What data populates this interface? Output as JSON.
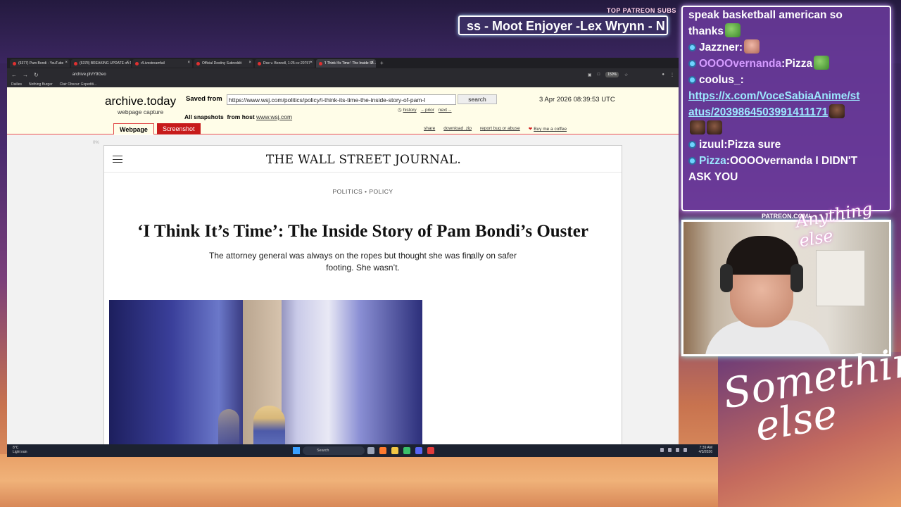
{
  "stream": {
    "patreon_label": "TOP PATREON SUBS",
    "ticker_text": "ss - Moot Enjoyer -Lex Wrynn -  N",
    "cam_label": "PATREON.COM/",
    "cam_signature": "Anything else",
    "big_signature": "Something else"
  },
  "chat": [
    {
      "user": "",
      "text": "speak basketball american so",
      "color": "#ffffff"
    },
    {
      "user": "",
      "text": "thanks",
      "color": "#ffffff",
      "emote": "frog"
    },
    {
      "user": "Jazzner",
      "text": "",
      "color": "#ffffff",
      "emote": "face"
    },
    {
      "user": "OOOOvernanda",
      "text": "Pizza",
      "color": "#d49bff",
      "emote": "frog"
    },
    {
      "user": "coolus_",
      "text": "",
      "color": "#ffffff"
    },
    {
      "user": "",
      "text": "https://x.com/VoceSabiaAnime/st",
      "color": "#9ce8ff",
      "link": true
    },
    {
      "user": "",
      "text": "atus/2039864503991411171",
      "color": "#9ce8ff",
      "link": true,
      "emote": "dark"
    },
    {
      "user": "izuul",
      "text": "Pizza sure",
      "color": "#ffffff"
    },
    {
      "user": "Pizza",
      "text": "OOOOvernanda I DIDN'T",
      "color": "#9ce8ff"
    },
    {
      "user": "",
      "text": "ASK YOU",
      "color": "#ffffff"
    }
  ],
  "browser": {
    "tabs": [
      {
        "label": "(6377) Pam Bondi - YouTube",
        "active": false
      },
      {
        "label": "(6378) BREAKING UPDATE on P...",
        "active": false
      },
      {
        "label": "r/Livestreamfail",
        "active": false
      },
      {
        "label": "Official Destiny Subreddit",
        "active": false
      },
      {
        "label": "Doe v. Bonnell, 1:25-cv-20757",
        "active": false
      },
      {
        "label": "'I Think It's Time': The Inside St...",
        "active": true
      }
    ],
    "url": "archive.ph/Y9Geo",
    "zoom": "150%",
    "bookmarks": [
      "Dailies",
      "Nothing Burger",
      "Clair Obscur: Expediti..."
    ]
  },
  "archive": {
    "title": "archive.today",
    "subtitle": "webpage capture",
    "saved_from_label": "Saved from",
    "saved_url": "https://www.wsj.com/politics/policy/i-think-its-time-the-inside-story-of-pam-l",
    "search_label": "search",
    "history_label": "history",
    "prior_label": "←prior",
    "next_label": "next→",
    "date": "3 Apr 2026 08:39:53 UTC",
    "all_snapshots_label": "All snapshots",
    "from_host_label": "from host",
    "host": "www.wsj.com",
    "tab_webpage": "Webpage",
    "tab_screenshot": "Screenshot",
    "links": {
      "share": "share",
      "download": "download .zip",
      "report": "report bug or abuse",
      "coffee": "Buy me a coffee"
    },
    "percent": "0%"
  },
  "article": {
    "logo": "THE WALL STREET JOURNAL.",
    "section": "POLITICS • POLICY",
    "headline": "‘I Think It’s Time’: The Inside Story of Pam Bondi’s Ouster",
    "dek": "The attorney general was always on the ropes but thought she was finally on safer footing. She wasn’t."
  },
  "taskbar": {
    "weather_temp": "8°C",
    "weather_desc": "Light rain",
    "search_placeholder": "Search",
    "time": "7:39 AM",
    "date": "4/3/2026"
  }
}
